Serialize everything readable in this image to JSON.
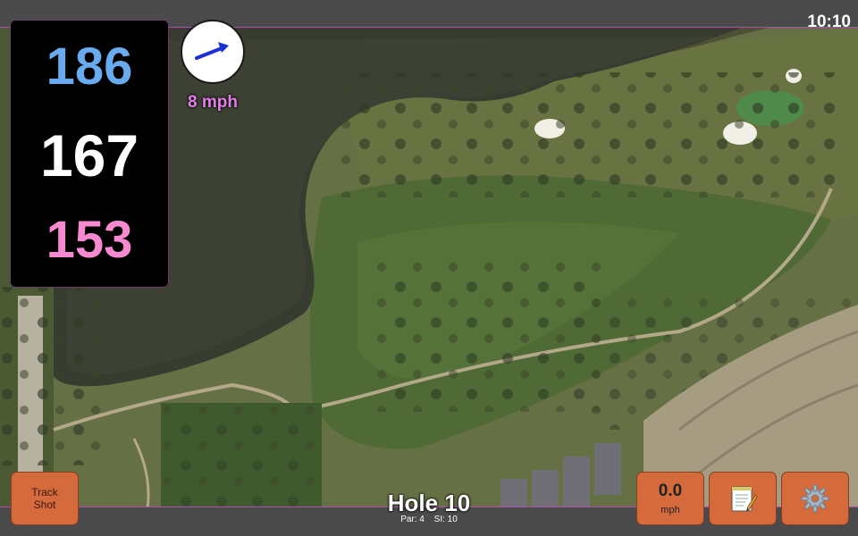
{
  "status_bar": {
    "time": "10:10"
  },
  "distances": {
    "back": "186",
    "middle": "167",
    "front": "153",
    "colors": {
      "back": "#6aabf0",
      "middle": "#ffffff",
      "front": "#f58ad0"
    }
  },
  "wind": {
    "speed": "8 mph",
    "arrow_icon": "wind-direction-arrow-icon",
    "arrow_color": "#1a2fd6"
  },
  "buttons": {
    "track_shot": {
      "line1": "Track",
      "line2": "Shot"
    },
    "speed": {
      "value": "0.0",
      "unit": "mph"
    },
    "notes": {
      "icon": "notepad-pencil-icon"
    },
    "settings": {
      "icon": "gear-icon"
    },
    "button_color": "#d56a3c"
  },
  "hole": {
    "title": "Hole 10",
    "par": "Par: 4",
    "si": "SI: 10"
  }
}
